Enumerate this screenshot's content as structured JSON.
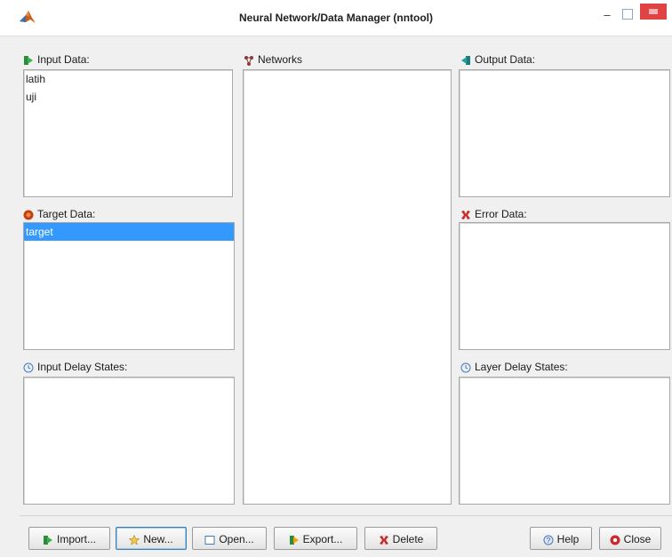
{
  "window": {
    "title": "Neural Network/Data Manager (nntool)"
  },
  "panels": {
    "input_data": {
      "label": "Input Data:",
      "items": [
        "latih",
        "uji"
      ]
    },
    "networks": {
      "label": "Networks",
      "items": []
    },
    "output_data": {
      "label": "Output Data:",
      "items": []
    },
    "target_data": {
      "label": "Target Data:",
      "items": [
        "target"
      ],
      "selected": "target"
    },
    "error_data": {
      "label": "Error Data:",
      "items": []
    },
    "input_delay_states": {
      "label": "Input Delay States:",
      "items": []
    },
    "layer_delay_states": {
      "label": "Layer Delay States:",
      "items": []
    }
  },
  "buttons": {
    "import": "Import...",
    "new": "New...",
    "open": "Open...",
    "export": "Export...",
    "delete": "Delete",
    "help": "Help",
    "close": "Close"
  },
  "colors": {
    "selection": "#3399ff",
    "close_button": "#e04343"
  },
  "icons": {
    "input_data": "green-arrow-in-icon",
    "networks": "network-icon",
    "output_data": "teal-arrow-out-icon",
    "target_data": "target-icon",
    "error_data": "error-icon",
    "delay_states": "clock-icon"
  }
}
